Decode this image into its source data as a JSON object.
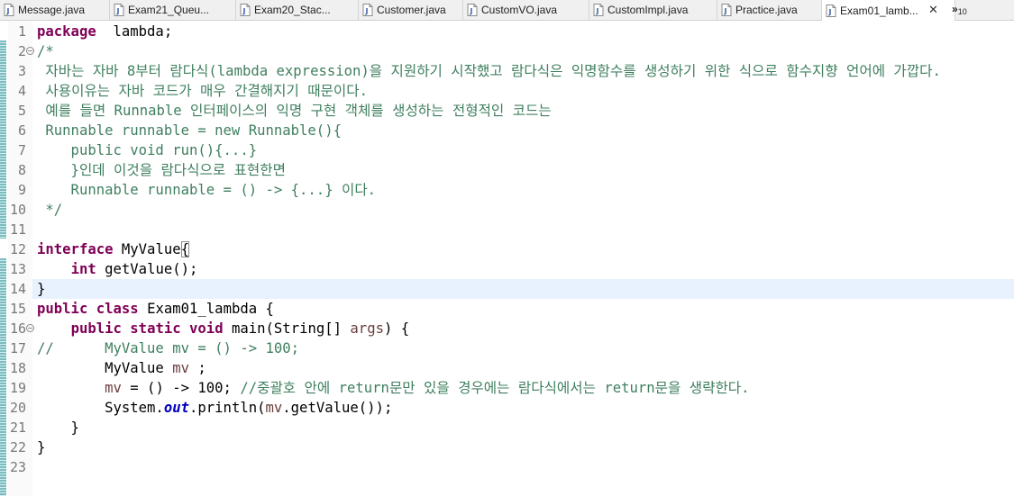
{
  "tabs": [
    {
      "label": "Message.java",
      "active": false
    },
    {
      "label": "Exam21_Queu...",
      "active": false
    },
    {
      "label": "Exam20_Stac...",
      "active": false
    },
    {
      "label": "Customer.java",
      "active": false
    },
    {
      "label": "CustomVO.java",
      "active": false
    },
    {
      "label": "CustomImpl.java",
      "active": false
    },
    {
      "label": "Practice.java",
      "active": false
    },
    {
      "label": "Exam01_lamb...",
      "active": true
    }
  ],
  "overflow": {
    "symbol": "»",
    "count": "10"
  },
  "current_line": 14,
  "lines": [
    {
      "n": "1",
      "parts": [
        [
          "kw",
          "package"
        ],
        [
          "",
          "  lambda;"
        ]
      ]
    },
    {
      "n": "2",
      "fold": true,
      "parts": [
        [
          "cm",
          "/*"
        ]
      ]
    },
    {
      "n": "3",
      "parts": [
        [
          "cm",
          " 자바는 자바 8부터 람다식(lambda expression)을 지원하기 시작했고 람다식은 익명함수를 생성하기 위한 식으로 함수지향 언어에 가깝다."
        ]
      ]
    },
    {
      "n": "4",
      "parts": [
        [
          "cm",
          " 사용이유는 자바 코드가 매우 간결해지기 때문이다."
        ]
      ]
    },
    {
      "n": "5",
      "parts": [
        [
          "cm",
          " 예를 들면 Runnable 인터페이스의 익명 구현 객체를 생성하는 전형적인 코드는"
        ]
      ]
    },
    {
      "n": "6",
      "parts": [
        [
          "cm",
          " Runnable runnable = new Runnable(){"
        ]
      ]
    },
    {
      "n": "7",
      "parts": [
        [
          "cm",
          "    public void run(){...}"
        ]
      ]
    },
    {
      "n": "8",
      "parts": [
        [
          "cm",
          "    }인데 이것을 람다식으로 표현한면"
        ]
      ]
    },
    {
      "n": "9",
      "parts": [
        [
          "cm",
          "    Runnable runnable = () -> {...} 이다."
        ]
      ]
    },
    {
      "n": "10",
      "parts": [
        [
          "cm",
          " */"
        ]
      ]
    },
    {
      "n": "11",
      "parts": []
    },
    {
      "n": "12",
      "parts": [
        [
          "kw",
          "interface"
        ],
        [
          "",
          " MyValue"
        ],
        [
          "hl",
          "{"
        ]
      ]
    },
    {
      "n": "13",
      "parts": [
        [
          "",
          "    "
        ],
        [
          "kw",
          "int"
        ],
        [
          "",
          " getValue();"
        ]
      ]
    },
    {
      "n": "14",
      "parts": [
        [
          "",
          "}"
        ]
      ]
    },
    {
      "n": "15",
      "parts": [
        [
          "kw",
          "public"
        ],
        [
          "",
          " "
        ],
        [
          "kw",
          "class"
        ],
        [
          "",
          " Exam01_lambda {"
        ]
      ]
    },
    {
      "n": "16",
      "fold": true,
      "parts": [
        [
          "",
          "    "
        ],
        [
          "kw",
          "public"
        ],
        [
          "",
          " "
        ],
        [
          "kw",
          "static"
        ],
        [
          "",
          " "
        ],
        [
          "kw",
          "void"
        ],
        [
          "",
          " main(String[] "
        ],
        [
          "var",
          "args"
        ],
        [
          "",
          ") {"
        ]
      ]
    },
    {
      "n": "17",
      "parts": [
        [
          "cm",
          "//      MyValue mv = () -> 100;"
        ]
      ]
    },
    {
      "n": "18",
      "parts": [
        [
          "",
          "        MyValue "
        ],
        [
          "var",
          "mv"
        ],
        [
          "",
          " ;"
        ]
      ]
    },
    {
      "n": "19",
      "parts": [
        [
          "",
          "        "
        ],
        [
          "var",
          "mv"
        ],
        [
          "",
          " = () -> 100; "
        ],
        [
          "cm",
          "//중괄호 안에 return문만 있을 경우에는 람다식에서는 return문을 생략한다."
        ]
      ]
    },
    {
      "n": "20",
      "parts": [
        [
          "",
          "        System."
        ],
        [
          "stat",
          "out"
        ],
        [
          "",
          ".println("
        ],
        [
          "var",
          "mv"
        ],
        [
          "",
          ".getValue());"
        ]
      ]
    },
    {
      "n": "21",
      "parts": [
        [
          "",
          "    }"
        ]
      ]
    },
    {
      "n": "22",
      "parts": [
        [
          "",
          "}"
        ]
      ]
    },
    {
      "n": "23",
      "parts": []
    }
  ]
}
